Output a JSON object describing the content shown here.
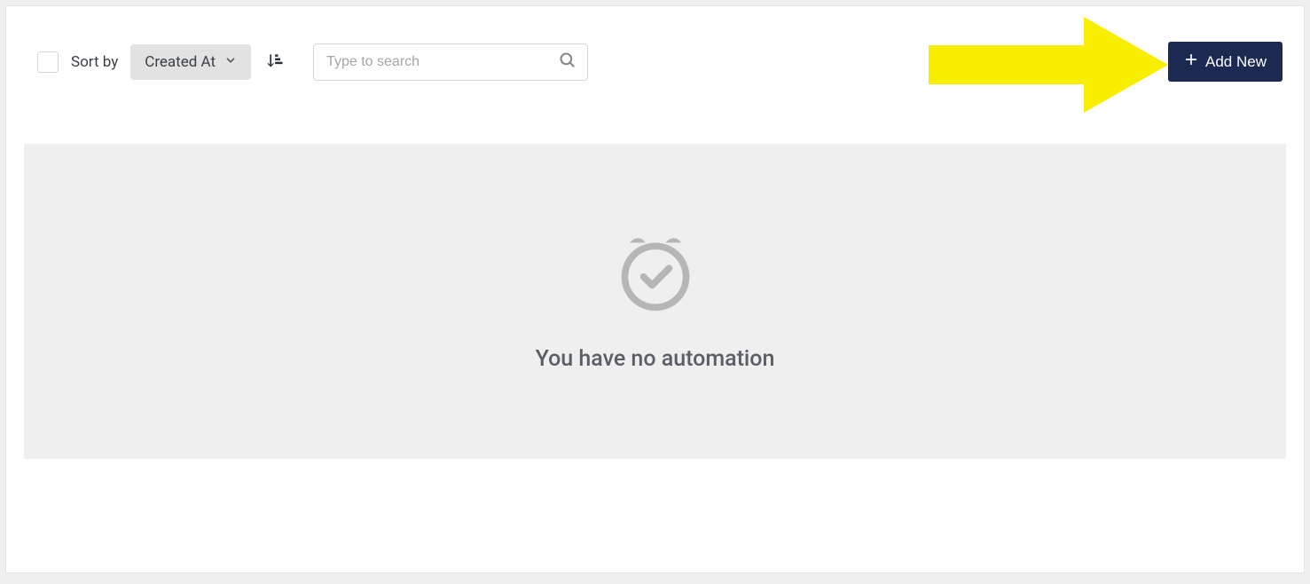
{
  "toolbar": {
    "sort_label": "Sort by",
    "sort_selected": "Created At"
  },
  "search": {
    "placeholder": "Type to search",
    "value": ""
  },
  "add_button": {
    "label": "Add New"
  },
  "empty_state": {
    "message": "You have no automation"
  }
}
